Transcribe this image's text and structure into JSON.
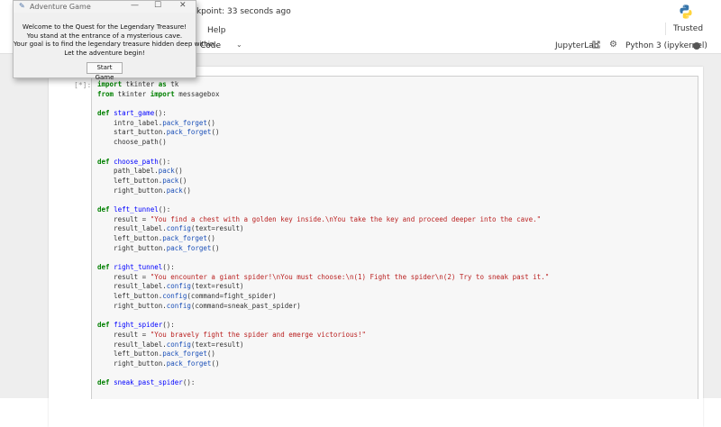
{
  "header": {
    "checkpoint": "ckpoint: 33 seconds ago"
  },
  "menubar": {
    "help": "Help",
    "trusted": "Trusted"
  },
  "toolbar": {
    "cell_type": "Code",
    "jupyterlab_link": "JupyterLab",
    "kernel_name": "Python 3 (ipykernel)"
  },
  "cell": {
    "prompt": "[*]:",
    "lines": [
      [
        {
          "t": "import",
          "c": "kw"
        },
        {
          "t": " tkinter "
        },
        {
          "t": "as",
          "c": "kw"
        },
        {
          "t": " tk"
        }
      ],
      [
        {
          "t": "from",
          "c": "kw"
        },
        {
          "t": " tkinter "
        },
        {
          "t": "import",
          "c": "kw"
        },
        {
          "t": " messagebox"
        }
      ],
      [],
      [
        {
          "t": "def",
          "c": "kw"
        },
        {
          "t": " "
        },
        {
          "t": "start_game",
          "c": "fn"
        },
        {
          "t": "():"
        }
      ],
      [
        {
          "t": "    intro_label."
        },
        {
          "t": "pack_forget",
          "c": "at"
        },
        {
          "t": "()"
        }
      ],
      [
        {
          "t": "    start_button."
        },
        {
          "t": "pack_forget",
          "c": "at"
        },
        {
          "t": "()"
        }
      ],
      [
        {
          "t": "    choose_path()"
        }
      ],
      [],
      [
        {
          "t": "def",
          "c": "kw"
        },
        {
          "t": " "
        },
        {
          "t": "choose_path",
          "c": "fn"
        },
        {
          "t": "():"
        }
      ],
      [
        {
          "t": "    path_label."
        },
        {
          "t": "pack",
          "c": "at"
        },
        {
          "t": "()"
        }
      ],
      [
        {
          "t": "    left_button."
        },
        {
          "t": "pack",
          "c": "at"
        },
        {
          "t": "()"
        }
      ],
      [
        {
          "t": "    right_button."
        },
        {
          "t": "pack",
          "c": "at"
        },
        {
          "t": "()"
        }
      ],
      [],
      [
        {
          "t": "def",
          "c": "kw"
        },
        {
          "t": " "
        },
        {
          "t": "left_tunnel",
          "c": "fn"
        },
        {
          "t": "():"
        }
      ],
      [
        {
          "t": "    result = "
        },
        {
          "t": "\"You find a chest with a golden key inside.\\nYou take the key and proceed deeper into the cave.\"",
          "c": "st"
        }
      ],
      [
        {
          "t": "    result_label."
        },
        {
          "t": "config",
          "c": "at"
        },
        {
          "t": "(text=result)"
        }
      ],
      [
        {
          "t": "    left_button."
        },
        {
          "t": "pack_forget",
          "c": "at"
        },
        {
          "t": "()"
        }
      ],
      [
        {
          "t": "    right_button."
        },
        {
          "t": "pack_forget",
          "c": "at"
        },
        {
          "t": "()"
        }
      ],
      [],
      [
        {
          "t": "def",
          "c": "kw"
        },
        {
          "t": " "
        },
        {
          "t": "right_tunnel",
          "c": "fn"
        },
        {
          "t": "():"
        }
      ],
      [
        {
          "t": "    result = "
        },
        {
          "t": "\"You encounter a giant spider!\\nYou must choose:\\n(1) Fight the spider\\n(2) Try to sneak past it.\"",
          "c": "st"
        }
      ],
      [
        {
          "t": "    result_label."
        },
        {
          "t": "config",
          "c": "at"
        },
        {
          "t": "(text=result)"
        }
      ],
      [
        {
          "t": "    left_button."
        },
        {
          "t": "config",
          "c": "at"
        },
        {
          "t": "(command=fight_spider)"
        }
      ],
      [
        {
          "t": "    right_button."
        },
        {
          "t": "config",
          "c": "at"
        },
        {
          "t": "(command=sneak_past_spider)"
        }
      ],
      [],
      [
        {
          "t": "def",
          "c": "kw"
        },
        {
          "t": " "
        },
        {
          "t": "fight_spider",
          "c": "fn"
        },
        {
          "t": "():"
        }
      ],
      [
        {
          "t": "    result = "
        },
        {
          "t": "\"You bravely fight the spider and emerge victorious!\"",
          "c": "st"
        }
      ],
      [
        {
          "t": "    result_label."
        },
        {
          "t": "config",
          "c": "at"
        },
        {
          "t": "(text=result)"
        }
      ],
      [
        {
          "t": "    left_button."
        },
        {
          "t": "pack_forget",
          "c": "at"
        },
        {
          "t": "()"
        }
      ],
      [
        {
          "t": "    right_button."
        },
        {
          "t": "pack_forget",
          "c": "at"
        },
        {
          "t": "()"
        }
      ],
      [],
      [
        {
          "t": "def",
          "c": "kw"
        },
        {
          "t": " "
        },
        {
          "t": "sneak_past_spider",
          "c": "fn"
        },
        {
          "t": "():"
        }
      ]
    ]
  },
  "dialog": {
    "title": "Adventure Game",
    "message": [
      "Welcome to the Quest for the Legendary Treasure!",
      "You stand at the entrance of a mysterious cave.",
      "Your goal is to find the legendary treasure hidden deep within.",
      "Let the adventure begin!"
    ],
    "button_label": "Start Game",
    "icons": {
      "app": "feather-icon",
      "minimize": "minimize-icon",
      "maximize": "maximize-icon",
      "close": "close-icon"
    }
  },
  "colors": {
    "keyword": "#008000",
    "function": "#0000ff",
    "string": "#ba2121",
    "attribute": "#1a4fb8"
  }
}
